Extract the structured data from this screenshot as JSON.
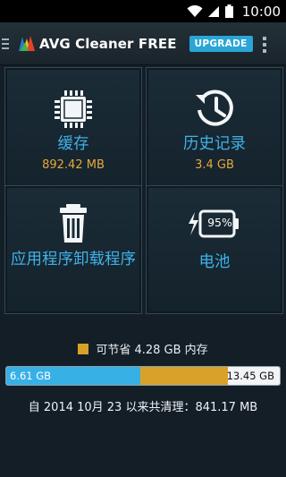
{
  "status_bar": {
    "time": "10:00",
    "icons": [
      "wifi-icon",
      "signal-icon",
      "battery-icon"
    ]
  },
  "action_bar": {
    "title": "AVG Cleaner FREE",
    "upgrade_label": "UPGRADE",
    "icons": [
      "menu-icon",
      "avg-logo-icon",
      "overflow-menu-icon"
    ]
  },
  "tiles": {
    "cache": {
      "label": "缓存",
      "value": "892.42 MB",
      "icon": "chip-icon"
    },
    "history": {
      "label": "历史记录",
      "value": "3.4 GB",
      "icon": "history-clock-icon"
    },
    "uninstall": {
      "label": "应用程序卸载程序",
      "icon": "trash-can-icon"
    },
    "battery": {
      "label": "电池",
      "percent": "95%",
      "icon": "battery-charging-icon"
    }
  },
  "storage": {
    "legend": "可节省 4.28 GB 内存",
    "used_label": "6.61 GB",
    "total_label": "13.45 GB",
    "used_fraction": 0.4915,
    "savable_fraction": 0.3182,
    "colors": {
      "used": "#37b0e6",
      "savable": "#d9a12a",
      "free": "#f2f4f5"
    }
  },
  "summary": "自 2014 10月 23 以来共清理：841.17 MB",
  "colors": {
    "accent_blue": "#3fb2e8",
    "accent_orange": "#e6a93a",
    "upgrade_bg": "#2aa6d6"
  }
}
